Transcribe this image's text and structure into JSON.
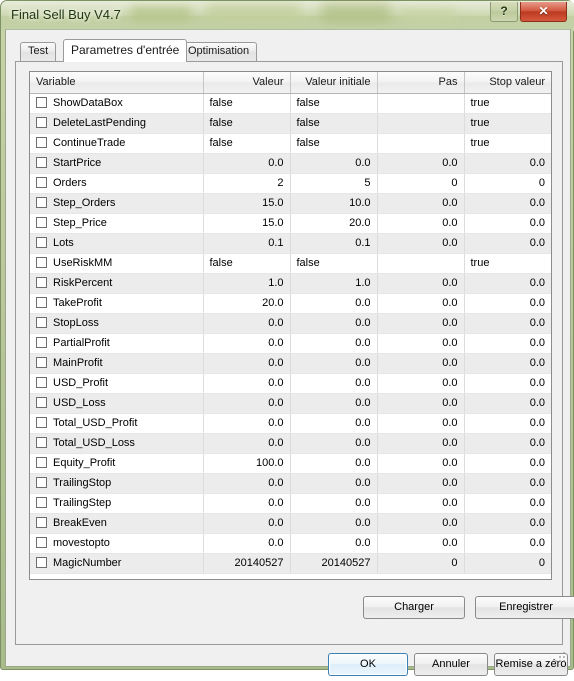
{
  "window": {
    "title": "Final Sell Buy V4.7",
    "help_label": "?",
    "close_label": "✕",
    "frame_color": "#b9c79a",
    "title_color": "#21380f"
  },
  "tabs": [
    {
      "label": "Test",
      "active": false
    },
    {
      "label": "Parametres d'entrée",
      "active": true
    },
    {
      "label": "Optimisation",
      "active": false
    }
  ],
  "table": {
    "columns": [
      {
        "label": "Variable",
        "align": "left"
      },
      {
        "label": "Valeur",
        "align": "right"
      },
      {
        "label": "Valeur initiale",
        "align": "right"
      },
      {
        "label": "Pas",
        "align": "right"
      },
      {
        "label": "Stop valeur",
        "align": "right"
      }
    ],
    "rows": [
      {
        "checked": false,
        "variable": "ShowDataBox",
        "valeur": "false",
        "valeur_initiale": "false",
        "pas": "",
        "stop_valeur": "true",
        "type": "bool"
      },
      {
        "checked": false,
        "variable": "DeleteLastPending",
        "valeur": "false",
        "valeur_initiale": "false",
        "pas": "",
        "stop_valeur": "true",
        "type": "bool"
      },
      {
        "checked": false,
        "variable": "ContinueTrade",
        "valeur": "false",
        "valeur_initiale": "false",
        "pas": "",
        "stop_valeur": "true",
        "type": "bool"
      },
      {
        "checked": false,
        "variable": "StartPrice",
        "valeur": "0.0",
        "valeur_initiale": "0.0",
        "pas": "0.0",
        "stop_valeur": "0.0",
        "type": "num"
      },
      {
        "checked": false,
        "variable": "Orders",
        "valeur": "2",
        "valeur_initiale": "5",
        "pas": "0",
        "stop_valeur": "0",
        "type": "num"
      },
      {
        "checked": false,
        "variable": "Step_Orders",
        "valeur": "15.0",
        "valeur_initiale": "10.0",
        "pas": "0.0",
        "stop_valeur": "0.0",
        "type": "num"
      },
      {
        "checked": false,
        "variable": "Step_Price",
        "valeur": "15.0",
        "valeur_initiale": "20.0",
        "pas": "0.0",
        "stop_valeur": "0.0",
        "type": "num"
      },
      {
        "checked": false,
        "variable": "Lots",
        "valeur": "0.1",
        "valeur_initiale": "0.1",
        "pas": "0.0",
        "stop_valeur": "0.0",
        "type": "num"
      },
      {
        "checked": false,
        "variable": "UseRiskMM",
        "valeur": "false",
        "valeur_initiale": "false",
        "pas": "",
        "stop_valeur": "true",
        "type": "bool"
      },
      {
        "checked": false,
        "variable": "RiskPercent",
        "valeur": "1.0",
        "valeur_initiale": "1.0",
        "pas": "0.0",
        "stop_valeur": "0.0",
        "type": "num"
      },
      {
        "checked": false,
        "variable": "TakeProfit",
        "valeur": "20.0",
        "valeur_initiale": "0.0",
        "pas": "0.0",
        "stop_valeur": "0.0",
        "type": "num"
      },
      {
        "checked": false,
        "variable": "StopLoss",
        "valeur": "0.0",
        "valeur_initiale": "0.0",
        "pas": "0.0",
        "stop_valeur": "0.0",
        "type": "num"
      },
      {
        "checked": false,
        "variable": "PartialProfit",
        "valeur": "0.0",
        "valeur_initiale": "0.0",
        "pas": "0.0",
        "stop_valeur": "0.0",
        "type": "num"
      },
      {
        "checked": false,
        "variable": "MainProfit",
        "valeur": "0.0",
        "valeur_initiale": "0.0",
        "pas": "0.0",
        "stop_valeur": "0.0",
        "type": "num"
      },
      {
        "checked": false,
        "variable": "USD_Profit",
        "valeur": "0.0",
        "valeur_initiale": "0.0",
        "pas": "0.0",
        "stop_valeur": "0.0",
        "type": "num"
      },
      {
        "checked": false,
        "variable": "USD_Loss",
        "valeur": "0.0",
        "valeur_initiale": "0.0",
        "pas": "0.0",
        "stop_valeur": "0.0",
        "type": "num"
      },
      {
        "checked": false,
        "variable": "Total_USD_Profit",
        "valeur": "0.0",
        "valeur_initiale": "0.0",
        "pas": "0.0",
        "stop_valeur": "0.0",
        "type": "num"
      },
      {
        "checked": false,
        "variable": "Total_USD_Loss",
        "valeur": "0.0",
        "valeur_initiale": "0.0",
        "pas": "0.0",
        "stop_valeur": "0.0",
        "type": "num"
      },
      {
        "checked": false,
        "variable": "Equity_Profit",
        "valeur": "100.0",
        "valeur_initiale": "0.0",
        "pas": "0.0",
        "stop_valeur": "0.0",
        "type": "num"
      },
      {
        "checked": false,
        "variable": "TrailingStop",
        "valeur": "0.0",
        "valeur_initiale": "0.0",
        "pas": "0.0",
        "stop_valeur": "0.0",
        "type": "num"
      },
      {
        "checked": false,
        "variable": "TrailingStep",
        "valeur": "0.0",
        "valeur_initiale": "0.0",
        "pas": "0.0",
        "stop_valeur": "0.0",
        "type": "num"
      },
      {
        "checked": false,
        "variable": "BreakEven",
        "valeur": "0.0",
        "valeur_initiale": "0.0",
        "pas": "0.0",
        "stop_valeur": "0.0",
        "type": "num"
      },
      {
        "checked": false,
        "variable": "movestopto",
        "valeur": "0.0",
        "valeur_initiale": "0.0",
        "pas": "0.0",
        "stop_valeur": "0.0",
        "type": "num"
      },
      {
        "checked": false,
        "variable": "MagicNumber",
        "valeur": "20140527",
        "valeur_initiale": "20140527",
        "pas": "0",
        "stop_valeur": "0",
        "type": "num"
      }
    ]
  },
  "file_buttons": {
    "charger": "Charger",
    "enregistrer": "Enregistrer"
  },
  "dialog_buttons": {
    "ok": "OK",
    "cancel": "Annuler",
    "reset": "Remise a zéro",
    "focus_color": "#3c7fb1"
  }
}
